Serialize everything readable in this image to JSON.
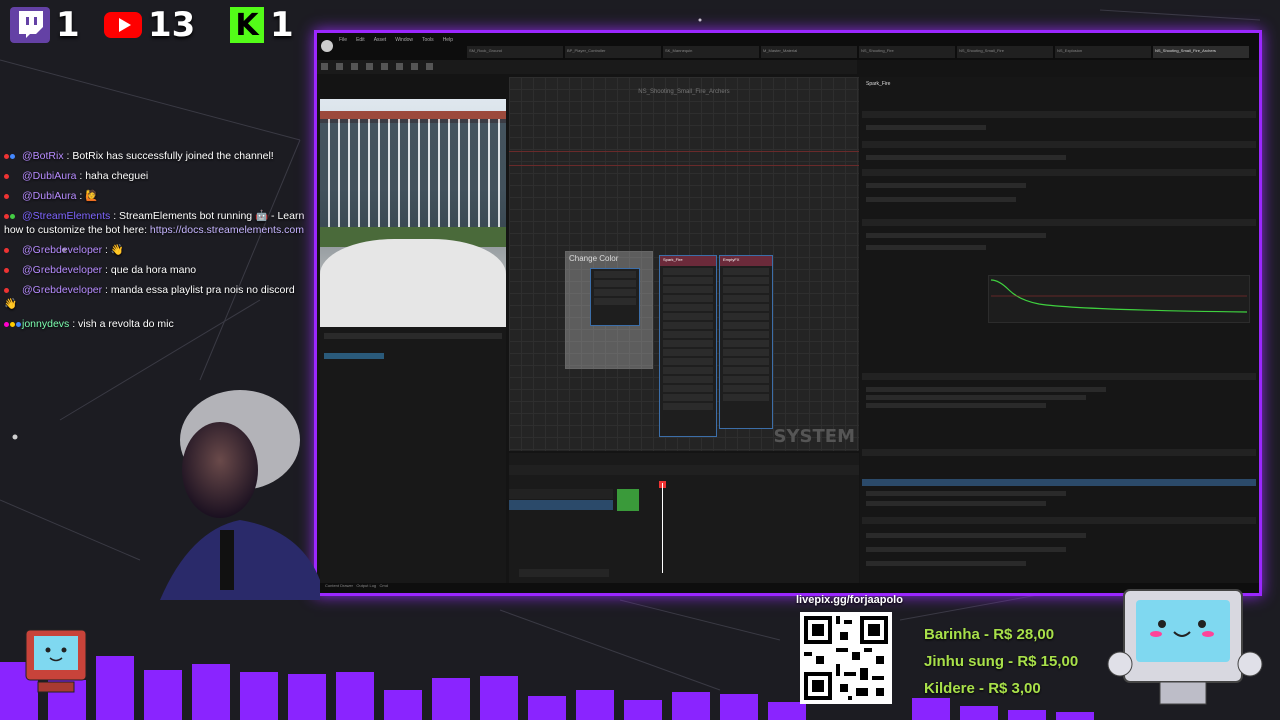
{
  "overlay": {
    "stats": [
      {
        "platform": "twitch",
        "icon": "twitch-icon",
        "count": "1"
      },
      {
        "platform": "youtube",
        "icon": "youtube-icon",
        "count": "13"
      },
      {
        "platform": "kick",
        "icon": "kick-icon",
        "count": "1"
      }
    ],
    "chat": [
      {
        "user": "@BotRix",
        "sep": " : ",
        "text": "BotRix has successfully joined the channel!",
        "link": ""
      },
      {
        "user": "@DubiAura",
        "sep": " : ",
        "text": "haha cheguei",
        "link": ""
      },
      {
        "user": "@DubiAura",
        "sep": " : ",
        "text": "🙋",
        "link": ""
      },
      {
        "user": "@StreamElements",
        "sep": " : ",
        "text": "StreamElements bot running 🤖 - Learn how to customize the bot here: ",
        "link": "https://docs.streamelements.com"
      },
      {
        "user": "@Grebdeveloper",
        "sep": " : ",
        "text": "👋",
        "link": ""
      },
      {
        "user": "@Grebdeveloper",
        "sep": " : ",
        "text": "que da hora mano",
        "link": ""
      },
      {
        "user": "@Grebdeveloper",
        "sep": " : ",
        "text": "manda essa playlist pra nois no discord 👋",
        "link": ""
      },
      {
        "user": "jonnydevs",
        "sep": " : ",
        "text": "vish a revolta do mic",
        "link": ""
      }
    ],
    "pix_label": "livepix.gg/forjaapolo",
    "donations": [
      {
        "name": "Barinha",
        "amount": "R$ 28,00"
      },
      {
        "name": "Jinhu sung",
        "amount": "R$ 15,00"
      },
      {
        "name": "Kildere",
        "amount": "R$ 3,00"
      }
    ],
    "accent": "#9b27ff",
    "bar_color": "#8a24ff",
    "donation_color": "#a8e04a"
  },
  "editor": {
    "menu": [
      "File",
      "Edit",
      "Asset",
      "Window",
      "Tools",
      "Help"
    ],
    "tabs": [
      "SM_Rock_Ground",
      "BP_Player_Controller",
      "SK_Mannequin",
      "M_Master_Material",
      "NS_Shooting_Fire",
      "NS_Shooting_Small_Fire",
      "NS_Explosion",
      "NS_Shooting_Small_Fire_Archers"
    ],
    "graph_title": "NS_Shooting_Small_Fire_Archers",
    "comment_title": "Change Color",
    "node_a_title": "Spark_Fire",
    "node_b_title": "EmptyFX",
    "system_label": "SYSTEM",
    "details_title": "Spark_Fire",
    "status_items": [
      "Content Drawer",
      "Output Log",
      "Cmd"
    ]
  }
}
